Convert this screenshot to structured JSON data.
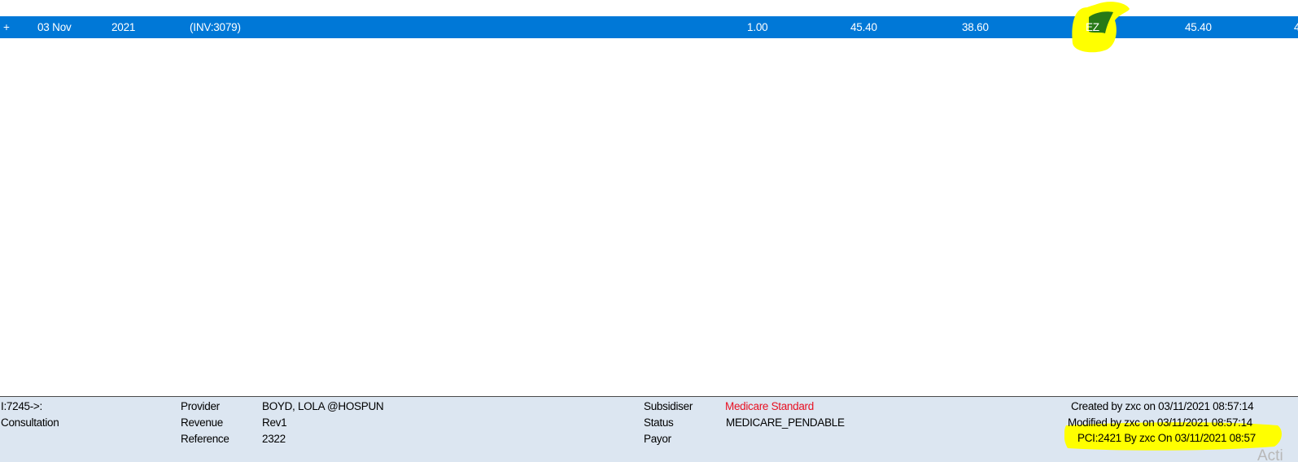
{
  "grid": {
    "selected_row": {
      "expand": "+",
      "date": "03 Nov",
      "year": "2021",
      "invoice": "(INV:3079)",
      "qty": "1.00",
      "amount1": "45.40",
      "amount2": "38.60",
      "code": "EZ",
      "amount3": "45.40",
      "truncated": "4"
    }
  },
  "footer": {
    "id_text": "I:7245->:",
    "item_type": "Consultation",
    "provider_label": "Provider",
    "provider_value": "BOYD, LOLA @HOSPUN",
    "revenue_label": "Revenue",
    "revenue_value": "Rev1",
    "reference_label": "Reference",
    "reference_value": "2322",
    "subsidiser_label": "Subsidiser",
    "subsidiser_value": "Medicare Standard",
    "status_label": "Status",
    "status_value": "MEDICARE_PENDABLE",
    "payor_label": "Payor",
    "created": "Created by zxc on 03/11/2021 08:57:14",
    "modified": "Modified by zxc on 03/11/2021 08:57:14",
    "pci": "PCI:2421 By zxc On 03/11/2021 08:57"
  },
  "overlay": {
    "activation_watermark": "Acti"
  },
  "colors": {
    "selection": "#0078d7",
    "footer_bg": "#dce6f1",
    "highlighter": "#ffff00",
    "subsidiser_red": "#e81123",
    "marker_green": "#0f6a1a"
  }
}
